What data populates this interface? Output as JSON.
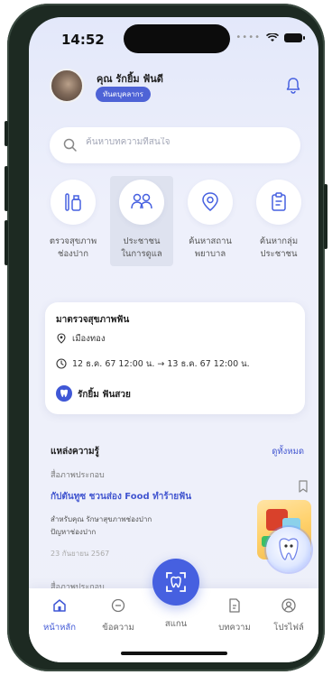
{
  "status_bar": {
    "time": "14:52"
  },
  "profile": {
    "name": "คุณ รักยิ้ม ฟันดี",
    "role": "ทันตบุคลากร"
  },
  "search": {
    "placeholder": "ค้นหาบทความที่สนใจ"
  },
  "quick_actions": [
    {
      "label_line1": "ตรวจสุขภาพ",
      "label_line2": "ช่องปาก",
      "icon": "toothbrush-icon"
    },
    {
      "label_line1": "ประชาชน",
      "label_line2": "ในการดูแล",
      "icon": "people-icon"
    },
    {
      "label_line1": "ค้นหาสถาน",
      "label_line2": "พยาบาล",
      "icon": "location-icon"
    },
    {
      "label_line1": "ค้นหากลุ่ม",
      "label_line2": "ประชาชน",
      "icon": "clipboard-icon"
    }
  ],
  "appointment": {
    "title": "มาตรวจสุขภาพฟัน",
    "location": "เมืองทอง",
    "date_range": "12 ธ.ค. 67 12:00 น. → 13 ธ.ค. 67 12:00 น.",
    "host": "รักยิ้ม ฟันสวย"
  },
  "knowledge": {
    "title": "แหล่งความรู้",
    "see_all": "ดูทั้งหมด",
    "articles": [
      {
        "category": "สื่อภาพประกอบ",
        "title": "กัปตันทูซ ชวนส่อง Food ทำร้ายฟัน",
        "tag1": "สำหรับคุณ รักษาสุขภาพช่องปาก",
        "tag2": "ปัญหาช่องปาก",
        "date": "23 กันยายน 2567"
      }
    ],
    "next_category": "สื่อภาพประกอบ"
  },
  "tabbar": {
    "home": "หน้าหลัก",
    "messages": "ข้อความ",
    "scan": "สแกน",
    "articles": "บทความ",
    "profile": "โปรไฟล์"
  },
  "colors": {
    "accent": "#4660e0",
    "link": "#4256d0",
    "background": "#eef0fb"
  }
}
